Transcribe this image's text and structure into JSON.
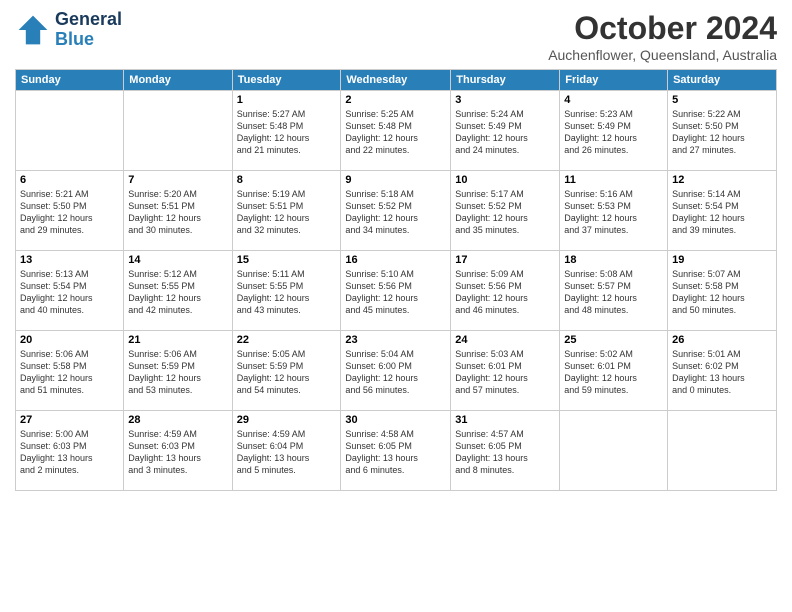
{
  "header": {
    "logo": {
      "line1": "General",
      "line2": "Blue"
    },
    "title": "October 2024",
    "subtitle": "Auchenflower, Queensland, Australia"
  },
  "weekdays": [
    "Sunday",
    "Monday",
    "Tuesday",
    "Wednesday",
    "Thursday",
    "Friday",
    "Saturday"
  ],
  "weeks": [
    [
      {
        "day": "",
        "info": ""
      },
      {
        "day": "",
        "info": ""
      },
      {
        "day": "1",
        "info": "Sunrise: 5:27 AM\nSunset: 5:48 PM\nDaylight: 12 hours\nand 21 minutes."
      },
      {
        "day": "2",
        "info": "Sunrise: 5:25 AM\nSunset: 5:48 PM\nDaylight: 12 hours\nand 22 minutes."
      },
      {
        "day": "3",
        "info": "Sunrise: 5:24 AM\nSunset: 5:49 PM\nDaylight: 12 hours\nand 24 minutes."
      },
      {
        "day": "4",
        "info": "Sunrise: 5:23 AM\nSunset: 5:49 PM\nDaylight: 12 hours\nand 26 minutes."
      },
      {
        "day": "5",
        "info": "Sunrise: 5:22 AM\nSunset: 5:50 PM\nDaylight: 12 hours\nand 27 minutes."
      }
    ],
    [
      {
        "day": "6",
        "info": "Sunrise: 5:21 AM\nSunset: 5:50 PM\nDaylight: 12 hours\nand 29 minutes."
      },
      {
        "day": "7",
        "info": "Sunrise: 5:20 AM\nSunset: 5:51 PM\nDaylight: 12 hours\nand 30 minutes."
      },
      {
        "day": "8",
        "info": "Sunrise: 5:19 AM\nSunset: 5:51 PM\nDaylight: 12 hours\nand 32 minutes."
      },
      {
        "day": "9",
        "info": "Sunrise: 5:18 AM\nSunset: 5:52 PM\nDaylight: 12 hours\nand 34 minutes."
      },
      {
        "day": "10",
        "info": "Sunrise: 5:17 AM\nSunset: 5:52 PM\nDaylight: 12 hours\nand 35 minutes."
      },
      {
        "day": "11",
        "info": "Sunrise: 5:16 AM\nSunset: 5:53 PM\nDaylight: 12 hours\nand 37 minutes."
      },
      {
        "day": "12",
        "info": "Sunrise: 5:14 AM\nSunset: 5:54 PM\nDaylight: 12 hours\nand 39 minutes."
      }
    ],
    [
      {
        "day": "13",
        "info": "Sunrise: 5:13 AM\nSunset: 5:54 PM\nDaylight: 12 hours\nand 40 minutes."
      },
      {
        "day": "14",
        "info": "Sunrise: 5:12 AM\nSunset: 5:55 PM\nDaylight: 12 hours\nand 42 minutes."
      },
      {
        "day": "15",
        "info": "Sunrise: 5:11 AM\nSunset: 5:55 PM\nDaylight: 12 hours\nand 43 minutes."
      },
      {
        "day": "16",
        "info": "Sunrise: 5:10 AM\nSunset: 5:56 PM\nDaylight: 12 hours\nand 45 minutes."
      },
      {
        "day": "17",
        "info": "Sunrise: 5:09 AM\nSunset: 5:56 PM\nDaylight: 12 hours\nand 46 minutes."
      },
      {
        "day": "18",
        "info": "Sunrise: 5:08 AM\nSunset: 5:57 PM\nDaylight: 12 hours\nand 48 minutes."
      },
      {
        "day": "19",
        "info": "Sunrise: 5:07 AM\nSunset: 5:58 PM\nDaylight: 12 hours\nand 50 minutes."
      }
    ],
    [
      {
        "day": "20",
        "info": "Sunrise: 5:06 AM\nSunset: 5:58 PM\nDaylight: 12 hours\nand 51 minutes."
      },
      {
        "day": "21",
        "info": "Sunrise: 5:06 AM\nSunset: 5:59 PM\nDaylight: 12 hours\nand 53 minutes."
      },
      {
        "day": "22",
        "info": "Sunrise: 5:05 AM\nSunset: 5:59 PM\nDaylight: 12 hours\nand 54 minutes."
      },
      {
        "day": "23",
        "info": "Sunrise: 5:04 AM\nSunset: 6:00 PM\nDaylight: 12 hours\nand 56 minutes."
      },
      {
        "day": "24",
        "info": "Sunrise: 5:03 AM\nSunset: 6:01 PM\nDaylight: 12 hours\nand 57 minutes."
      },
      {
        "day": "25",
        "info": "Sunrise: 5:02 AM\nSunset: 6:01 PM\nDaylight: 12 hours\nand 59 minutes."
      },
      {
        "day": "26",
        "info": "Sunrise: 5:01 AM\nSunset: 6:02 PM\nDaylight: 13 hours\nand 0 minutes."
      }
    ],
    [
      {
        "day": "27",
        "info": "Sunrise: 5:00 AM\nSunset: 6:03 PM\nDaylight: 13 hours\nand 2 minutes."
      },
      {
        "day": "28",
        "info": "Sunrise: 4:59 AM\nSunset: 6:03 PM\nDaylight: 13 hours\nand 3 minutes."
      },
      {
        "day": "29",
        "info": "Sunrise: 4:59 AM\nSunset: 6:04 PM\nDaylight: 13 hours\nand 5 minutes."
      },
      {
        "day": "30",
        "info": "Sunrise: 4:58 AM\nSunset: 6:05 PM\nDaylight: 13 hours\nand 6 minutes."
      },
      {
        "day": "31",
        "info": "Sunrise: 4:57 AM\nSunset: 6:05 PM\nDaylight: 13 hours\nand 8 minutes."
      },
      {
        "day": "",
        "info": ""
      },
      {
        "day": "",
        "info": ""
      }
    ]
  ]
}
